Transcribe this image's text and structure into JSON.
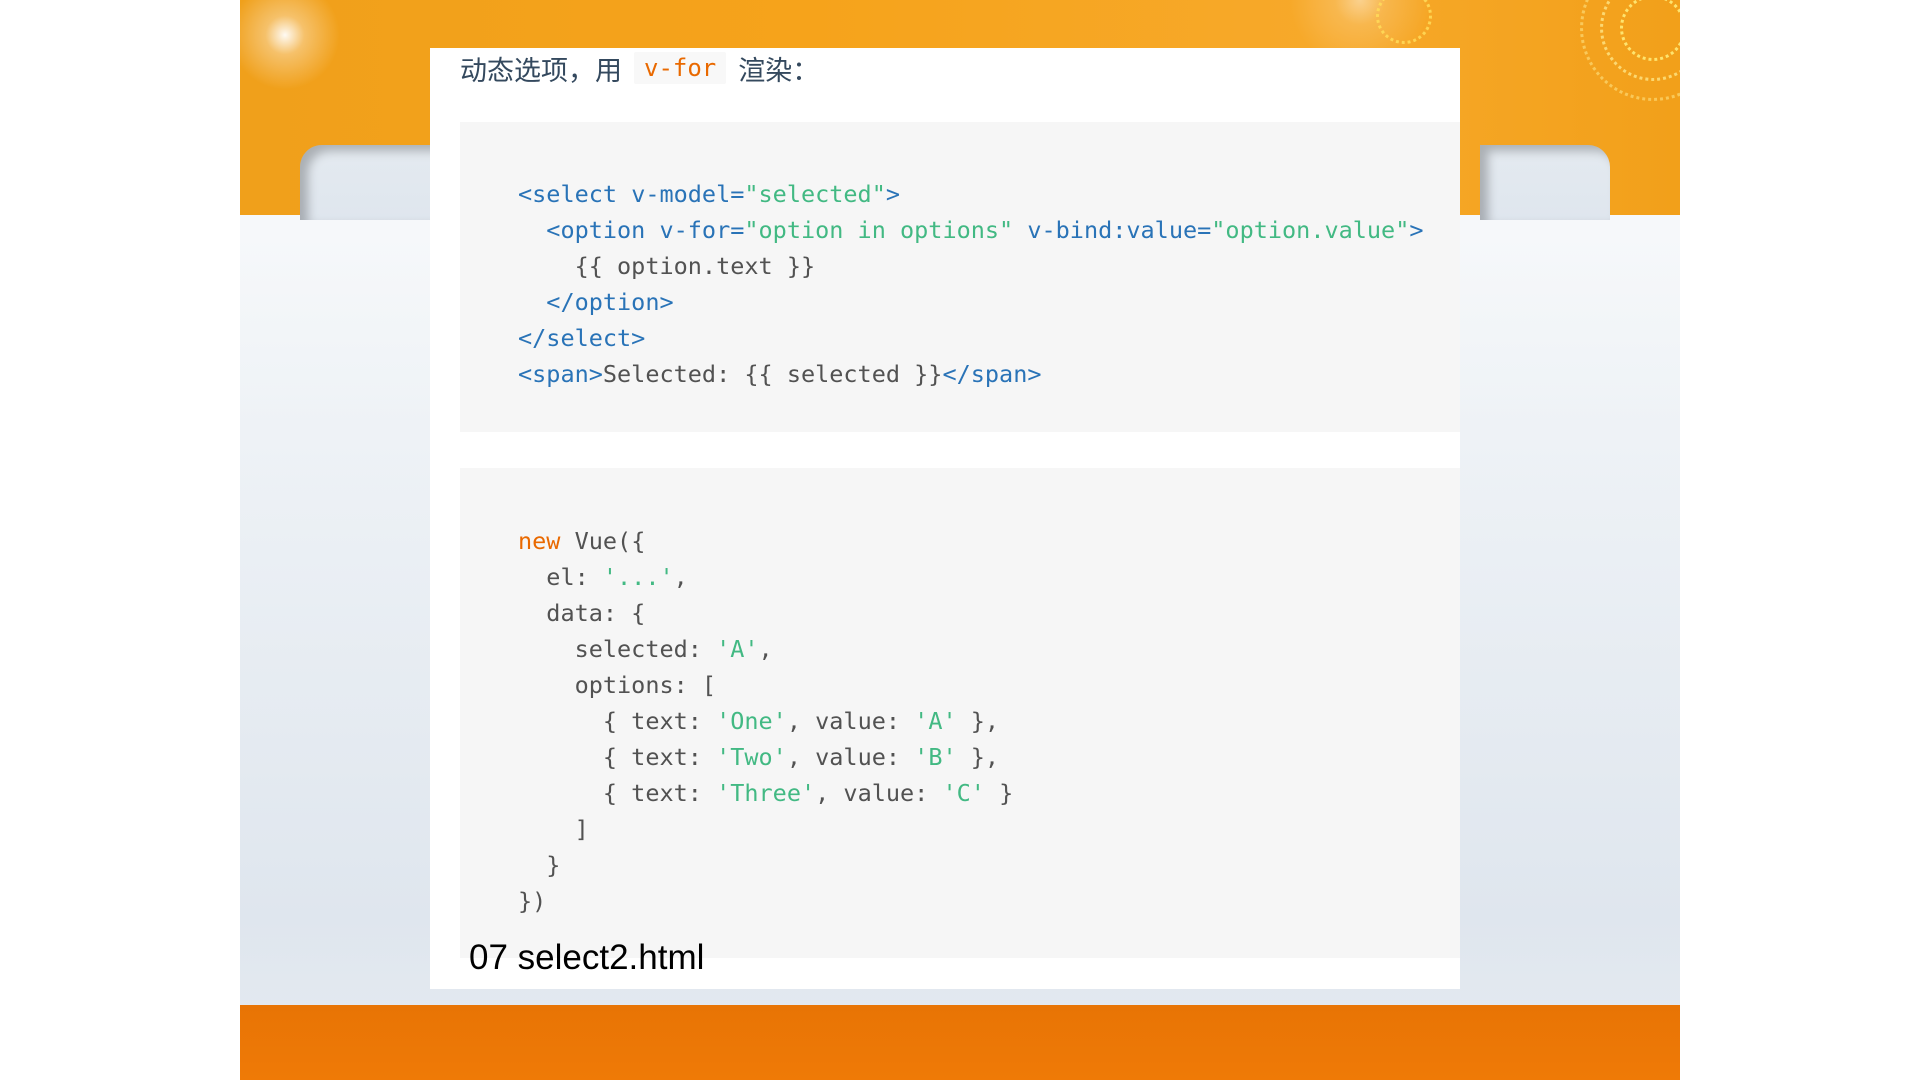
{
  "slide": {
    "intro_before": "动态选项，用",
    "intro_code": "v-for",
    "intro_after": "渲染：",
    "caption": "07 select2.html"
  },
  "code_html": {
    "line1": {
      "open": "<select ",
      "attr": "v-model=",
      "value": "\"selected\"",
      "close": ">"
    },
    "line2": {
      "open": "  <option ",
      "attr1": "v-for=",
      "value1": "\"option in options\"",
      "attr2": " v-bind:value=",
      "value2": "\"option.value\"",
      "close": ">"
    },
    "line3": "    {{ option.text }}",
    "line4": "  </option>",
    "line5": "</select>",
    "line6": {
      "open": "<span>",
      "text": "Selected: {{ selected }}",
      "close": "</span>"
    }
  },
  "code_js": {
    "line1": {
      "kw": "new",
      "rest": " Vue({"
    },
    "line2": {
      "pre": "  el: ",
      "str": "'...'",
      "post": ","
    },
    "line3": "  data: {",
    "line4": {
      "pre": "    selected: ",
      "str": "'A'",
      "post": ","
    },
    "line5": "    options: [",
    "line6": {
      "pre": "      { text: ",
      "str1": "'One'",
      "mid": ", value: ",
      "str2": "'A'",
      "post": " },"
    },
    "line7": {
      "pre": "      { text: ",
      "str1": "'Two'",
      "mid": ", value: ",
      "str2": "'B'",
      "post": " },"
    },
    "line8": {
      "pre": "      { text: ",
      "str1": "'Three'",
      "mid": ", value: ",
      "str2": "'C'",
      "post": " }"
    },
    "line9": "    ]",
    "line10": "  }",
    "line11": "})"
  },
  "colors": {
    "band_orange": "#f6a31b",
    "bottom_orange": "#ef7a06",
    "code_bg": "#f6f6f6",
    "tag_blue": "#2973b7",
    "string_green": "#42b983",
    "keyword_orange": "#e96900"
  }
}
